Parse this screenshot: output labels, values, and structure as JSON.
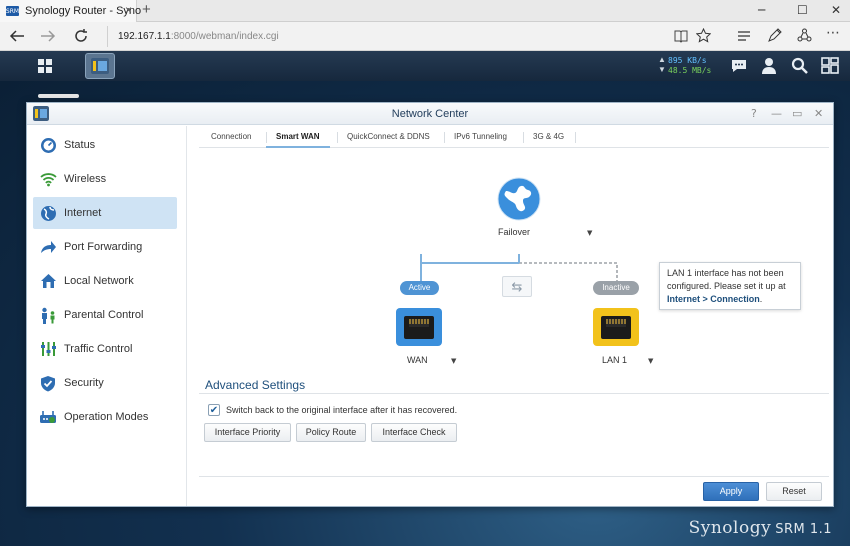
{
  "browser": {
    "tab_title": "Synology Router - Syno",
    "tab_favicon_text": "SRM",
    "tab_close": "×",
    "new_tab": "+",
    "win_min": "─",
    "win_max": "☐",
    "win_close": "✕",
    "url_host": "192.167.1.1",
    "url_path": ":8000/webman/index.cgi"
  },
  "dsm": {
    "upload_speed": "895 KB/s",
    "download_speed": "48.5 MB/s"
  },
  "window": {
    "title": "Network Center",
    "help": "?",
    "minimize": "—",
    "maximize": "▭",
    "close": "✕"
  },
  "sidebar": {
    "items": [
      {
        "label": "Status",
        "icon": "gauge-icon"
      },
      {
        "label": "Wireless",
        "icon": "wifi-icon"
      },
      {
        "label": "Internet",
        "icon": "globe-icon",
        "active": true
      },
      {
        "label": "Port Forwarding",
        "icon": "forward-arrow-icon"
      },
      {
        "label": "Local Network",
        "icon": "house-icon"
      },
      {
        "label": "Parental Control",
        "icon": "family-icon"
      },
      {
        "label": "Traffic Control",
        "icon": "sliders-icon"
      },
      {
        "label": "Security",
        "icon": "shield-icon"
      },
      {
        "label": "Operation Modes",
        "icon": "router-icon"
      }
    ]
  },
  "tabs": [
    {
      "label": "Connection"
    },
    {
      "label": "Smart WAN",
      "active": true
    },
    {
      "label": "QuickConnect & DDNS"
    },
    {
      "label": "IPv6 Tunneling"
    },
    {
      "label": "3G & 4G"
    }
  ],
  "diagram": {
    "mode": "Failover",
    "wan_status": "Active",
    "lan_status": "Inactive",
    "wan_label": "WAN",
    "lan_label": "LAN 1",
    "caret": "▼",
    "swap": "⇆",
    "tooltip_text": "LAN 1 interface has not been configured. Please set it up at",
    "tooltip_link": "Internet > Connection",
    "tooltip_end": ".",
    "colors": {
      "wan_port": "#3a8fdc",
      "lan_port": "#f2c21b",
      "active": "#4f94d4",
      "inactive": "#9aa1a8"
    }
  },
  "advanced": {
    "title": "Advanced Settings",
    "checkbox_label": "Switch back to the original interface after it has recovered.",
    "checked": true,
    "check_mark": "✔",
    "buttons": [
      "Interface Priority",
      "Policy Route",
      "Interface Check"
    ]
  },
  "footer": {
    "apply": "Apply",
    "reset": "Reset"
  },
  "brand": {
    "name": "Synology",
    "product": "SRM 1.1"
  }
}
